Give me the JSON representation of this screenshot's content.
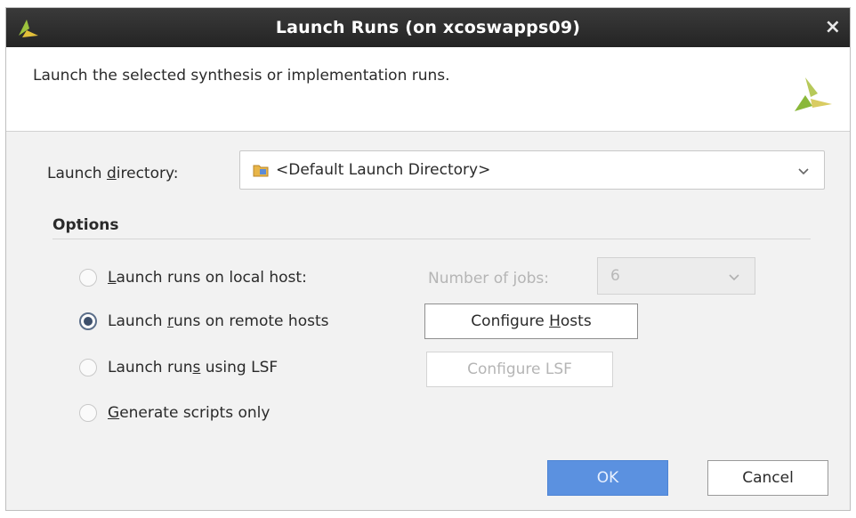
{
  "window": {
    "title": "Launch Runs (on xcoswapps09)",
    "close_glyph": "×",
    "logo_icon": "vivado-logo-icon"
  },
  "header": {
    "description": "Launch the selected synthesis or implementation runs.",
    "logo_icon": "vivado-logo-icon"
  },
  "launch_directory": {
    "label_pre": "Launch ",
    "label_mnemonic": "d",
    "label_post": "irectory:",
    "value": "<Default Launch Directory>",
    "folder_icon": "folder-icon"
  },
  "options": {
    "title": "Options",
    "radio_local": {
      "pre": "",
      "mnemonic": "L",
      "post": "aunch runs on local host:",
      "checked": false
    },
    "number_of_jobs": {
      "label_pre": "Number of ",
      "label_mnemonic": "j",
      "label_post": "obs:",
      "value": "6",
      "enabled": false
    },
    "radio_remote": {
      "pre": "Launch ",
      "mnemonic": "r",
      "post": "uns on remote hosts",
      "checked": true
    },
    "configure_hosts": {
      "pre": "Configure ",
      "mnemonic": "H",
      "post": "osts"
    },
    "radio_lsf": {
      "pre": "Launch run",
      "mnemonic": "s",
      "post": " using LSF",
      "checked": false
    },
    "configure_lsf": {
      "label": "Configure LSF",
      "enabled": false
    },
    "radio_scripts": {
      "pre": "",
      "mnemonic": "G",
      "post": "enerate scripts only",
      "checked": false
    }
  },
  "buttons": {
    "ok": "OK",
    "cancel": "Cancel"
  },
  "colors": {
    "titlebar": "#2b2b2b",
    "ok_button": "#5b91e0",
    "logo_green": "#8ab83a"
  }
}
